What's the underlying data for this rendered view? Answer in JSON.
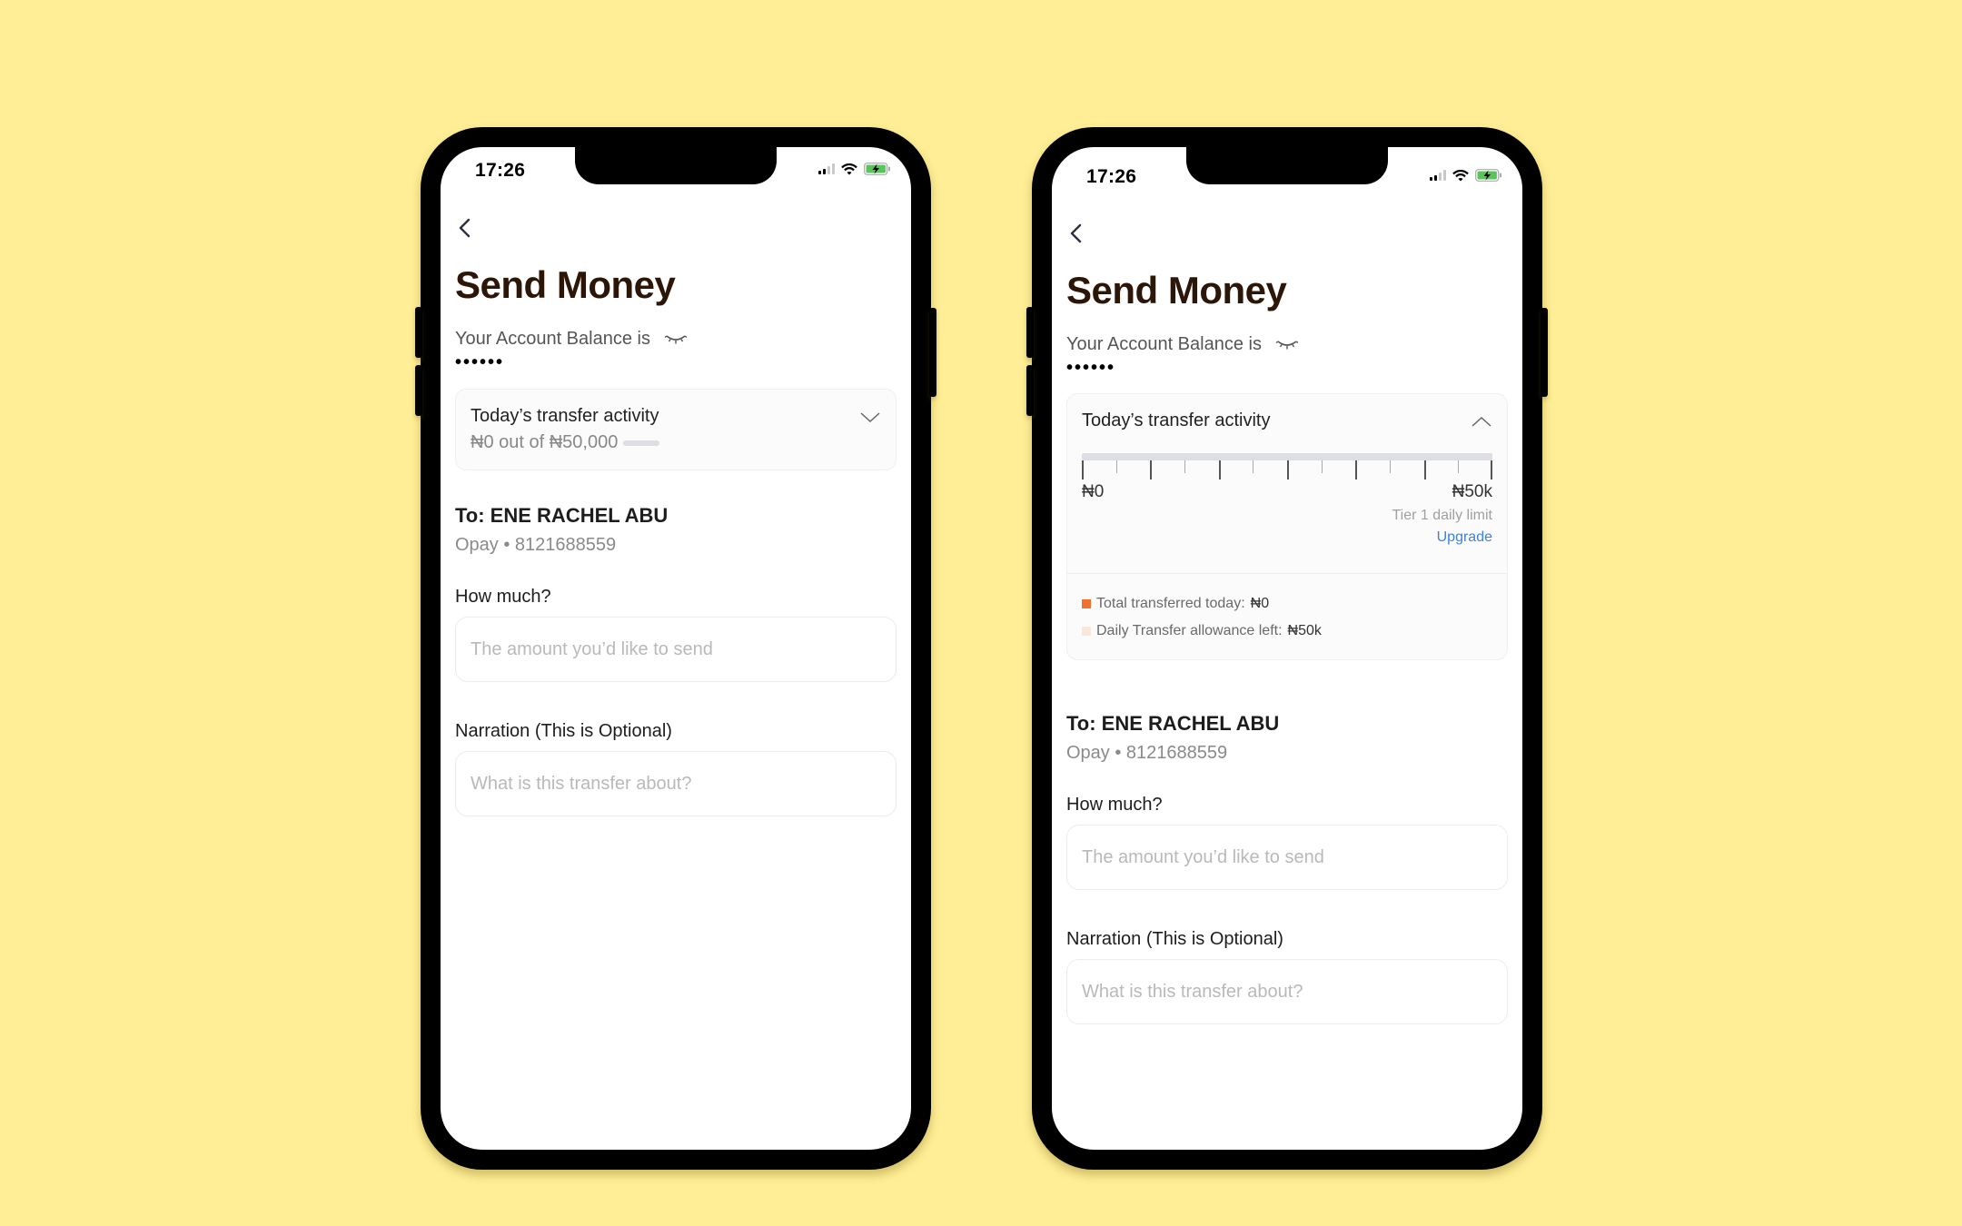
{
  "phones": [
    {
      "id": "collapsed",
      "status_bar": {
        "time": "17:26",
        "signal_bars_on": 2,
        "signal_bars_total": 4,
        "battery": "charging"
      },
      "back_icon": "chevron-left-icon",
      "title": "Send Money",
      "balance_label": "Your Account Balance is",
      "balance_toggle_icon": "eye-closed-icon",
      "balance_value": "••••••",
      "transfer_activity": {
        "title": "Today’s transfer activity",
        "expanded": false,
        "toggle_icon": "chevron-down-icon",
        "summary": "₦0 out of ₦50,000",
        "progress": 0
      },
      "recipient": {
        "name": "To: ENE RACHEL ABU",
        "details": "Opay • 8121688559"
      },
      "amount": {
        "label": "How much?",
        "placeholder": "The amount you’d like to send",
        "value": ""
      },
      "narration": {
        "label": "Narration (This is Optional)",
        "placeholder": "What is this transfer about?",
        "value": ""
      }
    },
    {
      "id": "expanded",
      "status_bar": {
        "time": "17:26",
        "signal_bars_on": 2,
        "signal_bars_total": 4,
        "battery": "charging"
      },
      "back_icon": "chevron-left-icon",
      "title": "Send Money",
      "balance_label": "Your Account Balance is",
      "balance_toggle_icon": "eye-closed-icon",
      "balance_value": "••••••",
      "transfer_activity": {
        "title": "Today’s transfer activity",
        "expanded": true,
        "toggle_icon": "chevron-up-icon",
        "progress": 0,
        "scale_min_label": "₦0",
        "scale_max_label": "₦50k",
        "tick_count": 13,
        "limit_label": "Tier 1 daily limit",
        "upgrade_label": "Upgrade",
        "legend": [
          {
            "label": "Total transferred today:",
            "value": "₦0",
            "color": "#F07030"
          },
          {
            "label": "Daily Transfer allowance left:",
            "value": "₦50k",
            "color": "#FBE6DA"
          }
        ]
      },
      "recipient": {
        "name": "To: ENE RACHEL ABU",
        "details": "Opay • 8121688559"
      },
      "amount": {
        "label": "How much?",
        "placeholder": "The amount you’d like to send",
        "value": ""
      },
      "narration": {
        "label": "Narration (This is Optional)",
        "placeholder": "What is this transfer about?",
        "value": ""
      }
    }
  ],
  "colors": {
    "background": "#FFEE95",
    "title": "#2B1608",
    "link": "#3C82D8",
    "battery": "#5BC35B"
  }
}
